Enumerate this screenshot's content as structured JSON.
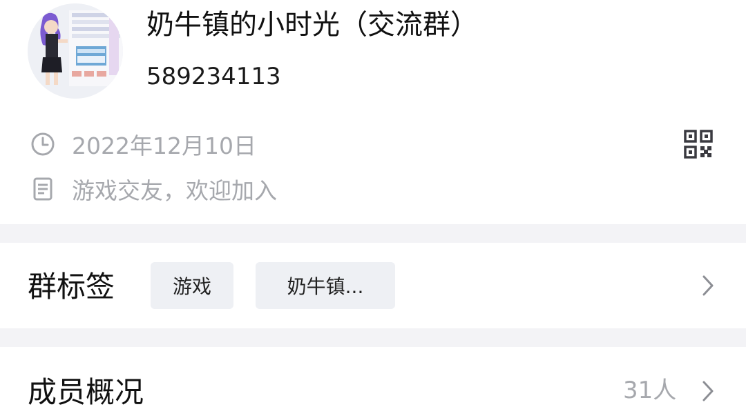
{
  "group": {
    "name": "奶牛镇的小时光（交流群）",
    "id": "589234113",
    "avatar_icon": "avatar-icon"
  },
  "info": {
    "created_date": "2022年12月10日",
    "description": "游戏交友，欢迎加入",
    "clock_icon": "clock-icon",
    "document_icon": "document-icon",
    "qr_icon": "qr-code-icon"
  },
  "tags_section": {
    "title": "群标签",
    "tags": [
      "游戏",
      "奶牛镇..."
    ]
  },
  "members_section": {
    "title": "成员概况",
    "count": "31人"
  },
  "colors": {
    "primary_text": "#111111",
    "secondary_text": "#a6a8ad",
    "separator": "#f3f3f6",
    "tag_bg": "#eef0f4"
  }
}
